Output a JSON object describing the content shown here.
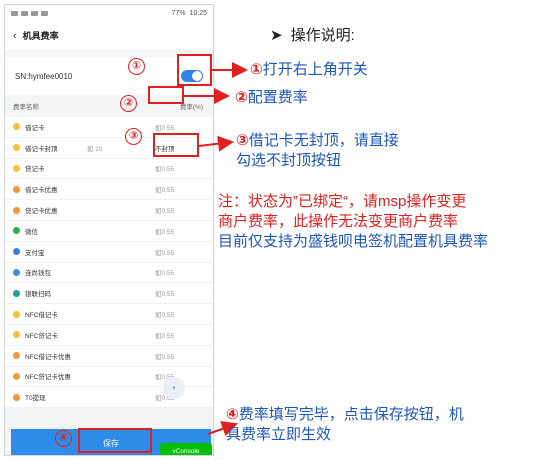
{
  "status": {
    "battery": "77%",
    "time": "10:25"
  },
  "nav": {
    "title": "机具费率"
  },
  "sn": {
    "label": "SN:hymfee0010"
  },
  "table": {
    "col_name": "费率名称",
    "col_rate": "费率(%)",
    "rows": [
      {
        "name": "借记卡",
        "value": "如0.55",
        "color": "#f4c23a"
      },
      {
        "name": "借记卡封顶",
        "extra": "如 20",
        "value": "不封顶",
        "color": "#f4c23a"
      },
      {
        "name": "贷记卡",
        "value": "如0.55",
        "color": "#f4c23a"
      },
      {
        "name": "借记卡优惠",
        "value": "如0.55",
        "color": "#f29a3a"
      },
      {
        "name": "贷记卡优惠",
        "value": "如0.55",
        "color": "#f29a3a"
      },
      {
        "name": "微信",
        "value": "如0.55",
        "color": "#2ab24a"
      },
      {
        "name": "支付宝",
        "value": "如0.55",
        "color": "#2f83e6"
      },
      {
        "name": "连尚钱包",
        "value": "如0.55",
        "color": "#3a8de0"
      },
      {
        "name": "银联扫码",
        "value": "如0.55",
        "color": "#1aa0a0"
      },
      {
        "name": "NFC借记卡",
        "value": "如0.55",
        "color": "#f4c23a"
      },
      {
        "name": "NFC贷记卡",
        "value": "如0.55",
        "color": "#f4c23a"
      },
      {
        "name": "NFC借记卡优惠",
        "value": "如0.55",
        "color": "#f29a3a"
      },
      {
        "name": "NFC贷记卡优惠",
        "value": "如0.55",
        "color": "#f29a3a"
      },
      {
        "name": "T0提现",
        "value": "如0.55",
        "color": "#f29a3a"
      }
    ]
  },
  "bottom": {
    "save_label": "保存",
    "vconsole_label": "vConsole"
  },
  "annotations": {
    "title": "操作说明:",
    "n1": "①",
    "n2": "②",
    "n3": "③",
    "n4": "④",
    "a1": "打开右上角开关",
    "a2": "配置费率",
    "a3_line1": "借记卡无封顶，请直接",
    "a3_line2": "勾选不封顶按钮",
    "note_line1": "注：状态为”已绑定“，请msp操作变更",
    "note_line2": "商户费率，此操作无法变更商户费率",
    "note_line3": "目前仅支持为盛钱呗电签机配置机具费率",
    "a4_line1": "费率填写完毕，点击保存按钮，机",
    "a4_line2": "具费率立即生效"
  },
  "colors": {
    "accent": "#2f83e6",
    "annotation_red": "#e02020",
    "annotation_blue": "#1f57b8"
  }
}
